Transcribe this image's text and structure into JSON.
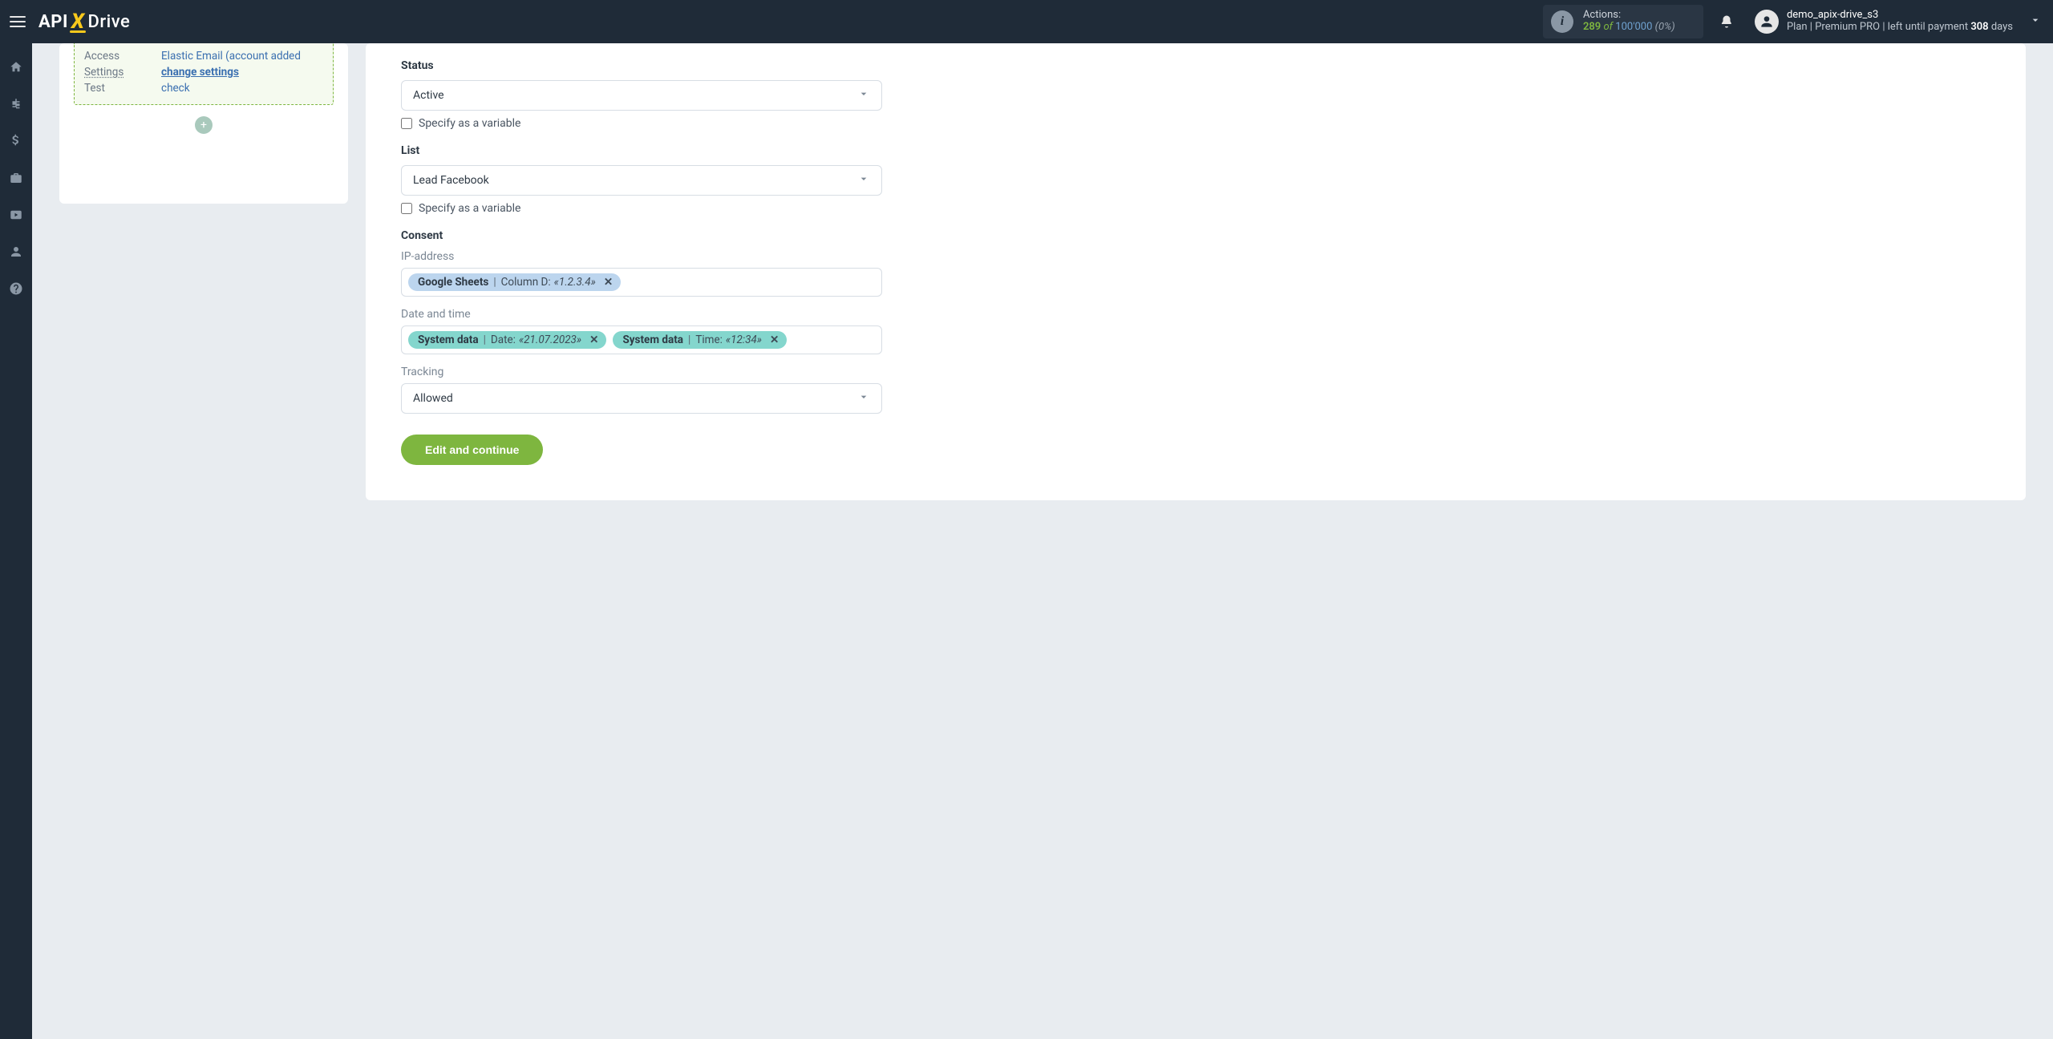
{
  "header": {
    "logo": {
      "api": "API",
      "x": "X",
      "drive": "Drive"
    },
    "actions": {
      "label": "Actions:",
      "count": "289",
      "of": "of",
      "total": "100'000",
      "pct": "(0%)"
    },
    "user": {
      "name": "demo_apix-drive_s3",
      "plan_prefix": "Plan  |",
      "plan_name": "Premium PRO",
      "plan_suffix": "|  left until payment",
      "days": "308",
      "days_label": "days"
    }
  },
  "config": {
    "rows": [
      {
        "k": "Access",
        "v": "Elastic Email (account added",
        "kclass": "",
        "vclass": ""
      },
      {
        "k": "Settings",
        "v": "change settings",
        "kclass": "ul",
        "vclass": "bold"
      },
      {
        "k": "Test",
        "v": "check",
        "kclass": "",
        "vclass": ""
      }
    ]
  },
  "form": {
    "status_label": "Status",
    "status_value": "Active",
    "specify_variable": "Specify as a variable",
    "list_label": "List",
    "list_value": "Lead Facebook",
    "consent_label": "Consent",
    "ip_label": "IP-address",
    "ip_tag": {
      "src": "Google Sheets",
      "mid": "Column D:",
      "val": "«1.2.3.4»"
    },
    "dt_label": "Date and time",
    "dt_tags": [
      {
        "src": "System data",
        "mid": "Date:",
        "val": "«21.07.2023»"
      },
      {
        "src": "System data",
        "mid": "Time:",
        "val": "«12:34»"
      }
    ],
    "tracking_label": "Tracking",
    "tracking_value": "Allowed",
    "submit": "Edit and continue"
  }
}
